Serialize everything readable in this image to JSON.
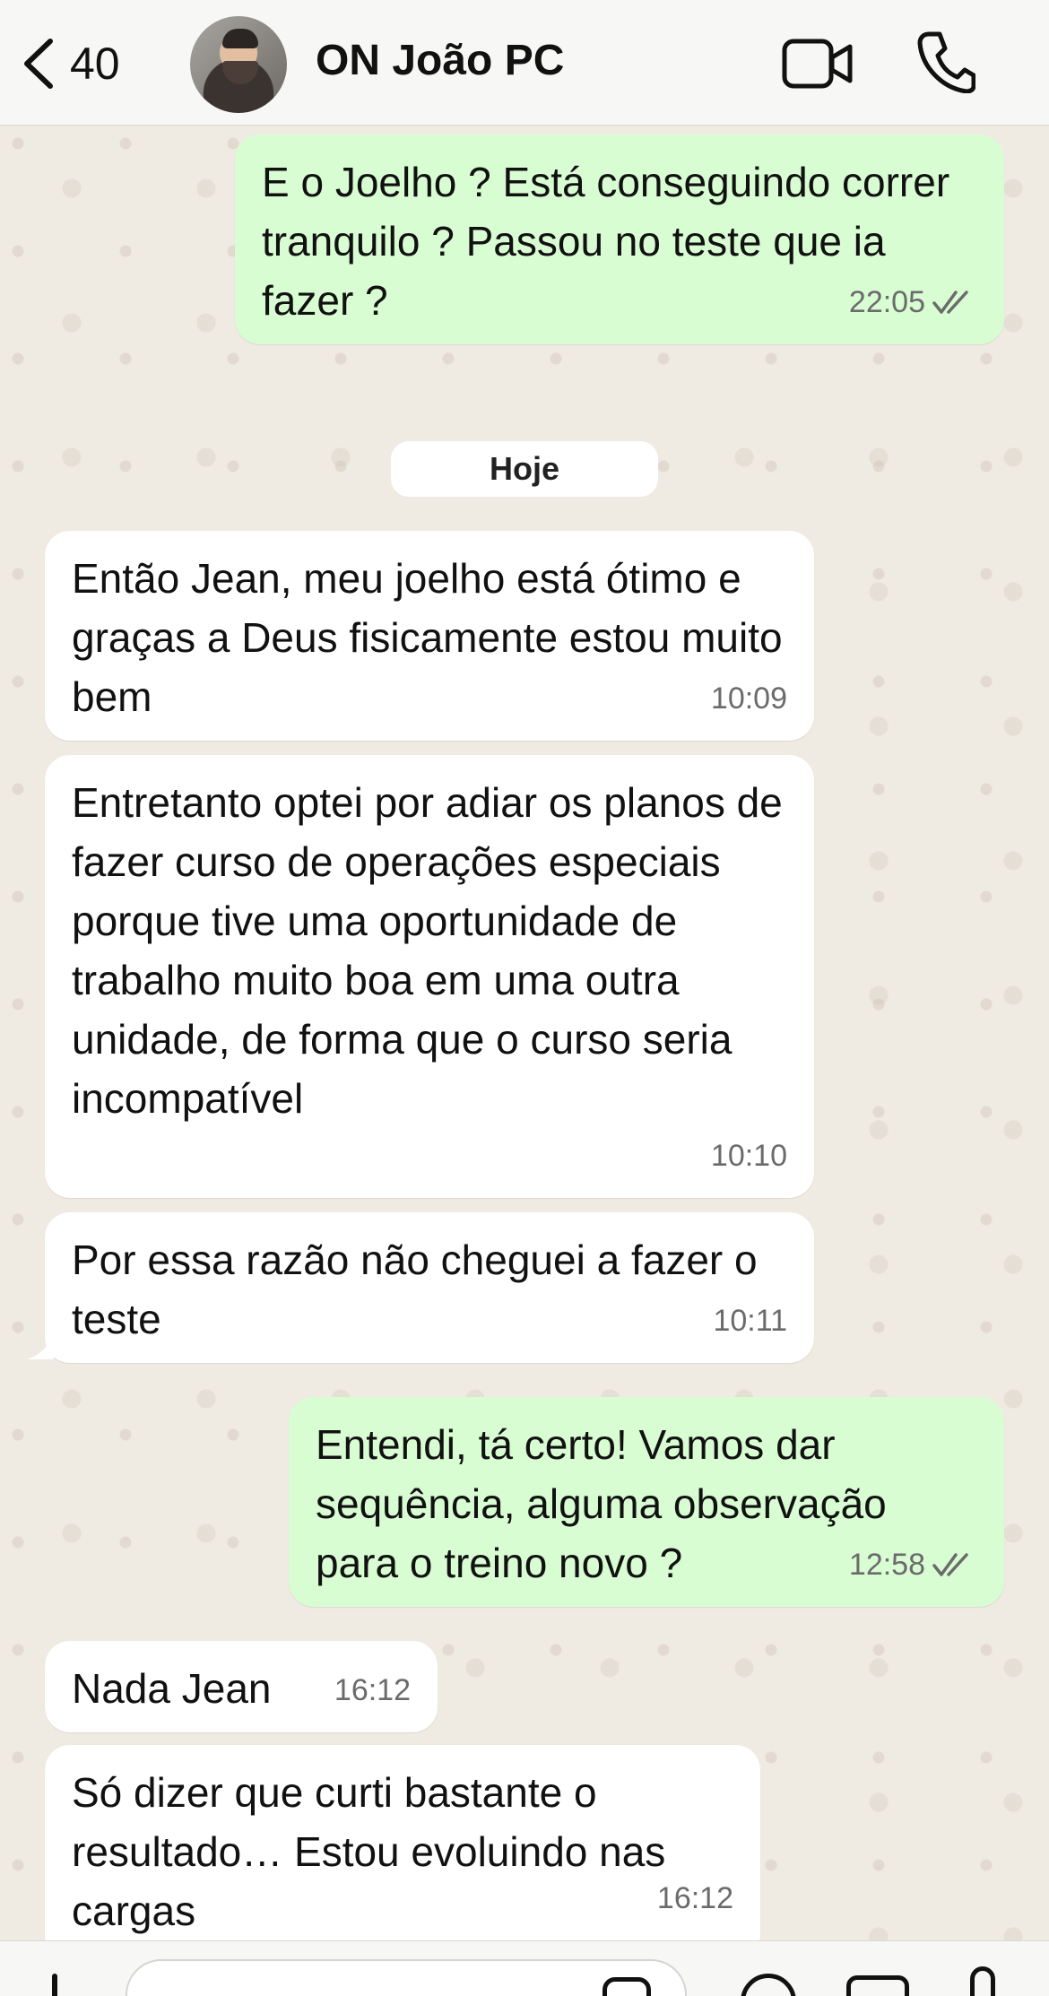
{
  "header": {
    "back_count": "40",
    "contact_name": "ON João PC",
    "icons": {
      "back": "chevron-left-icon",
      "video": "video-camera-icon",
      "call": "phone-icon"
    }
  },
  "chat": {
    "date_separator": "Hoje",
    "messages": [
      {
        "direction": "out",
        "text": "E o Joelho ? Está conseguindo correr tranquilo ? Passou no teste que ia fazer ?",
        "time": "22:05",
        "status": "read"
      },
      {
        "direction": "in",
        "text": "Então Jean, meu joelho está ótimo e graças a Deus fisicamente estou muito bem",
        "time": "10:09"
      },
      {
        "direction": "in",
        "text": "Entretanto optei por adiar os planos de fazer curso de operações especiais porque tive uma oportunidade de trabalho muito boa em uma outra unidade, de forma que o curso seria incompatível",
        "time": "10:10"
      },
      {
        "direction": "in",
        "text": "Por essa razão não cheguei a fazer o teste",
        "time": "10:11"
      },
      {
        "direction": "out",
        "text": "Entendi, tá certo! Vamos dar sequência, alguma observação para o treino novo ?",
        "time": "12:58",
        "status": "read"
      },
      {
        "direction": "in",
        "text": "Nada Jean",
        "time": "16:12"
      },
      {
        "direction": "in",
        "text": "Só dizer que curti bastante o resultado… Estou evoluindo nas cargas",
        "time": "16:12"
      }
    ]
  },
  "colors": {
    "outgoing_bubble": "#d9fdd3",
    "incoming_bubble": "#ffffff",
    "chat_background": "#efeae2",
    "read_ticks": "#6b6b6b"
  },
  "input_bar": {
    "icons": [
      "plus-icon",
      "sticker-icon",
      "payment-icon",
      "camera-icon",
      "microphone-icon"
    ]
  }
}
